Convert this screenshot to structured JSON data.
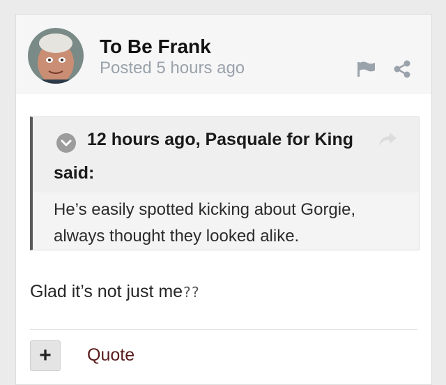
{
  "post": {
    "author": "To Be Frank",
    "meta": "Posted 5 hours ago"
  },
  "icons": {
    "report": "flag-icon",
    "share": "share-icon",
    "toggle": "chevron-down-icon",
    "jump": "reply-arrow-icon"
  },
  "quote": {
    "citation_line1": "12 hours ago, Pasquale for King",
    "citation_line2": "said:",
    "body": "He’s easily spotted kicking about Gorgie, always thought they looked alike."
  },
  "content": {
    "text": "Glad it’s not just me",
    "trailing_glyphs": "??"
  },
  "footer": {
    "plus_label": "+",
    "quote_label": "Quote"
  },
  "colors": {
    "header_bg": "#f6f6f6",
    "meta_text": "#9aa2ab",
    "quote_button": "#5a1a1a",
    "quote_border": "#5a5a5a"
  }
}
